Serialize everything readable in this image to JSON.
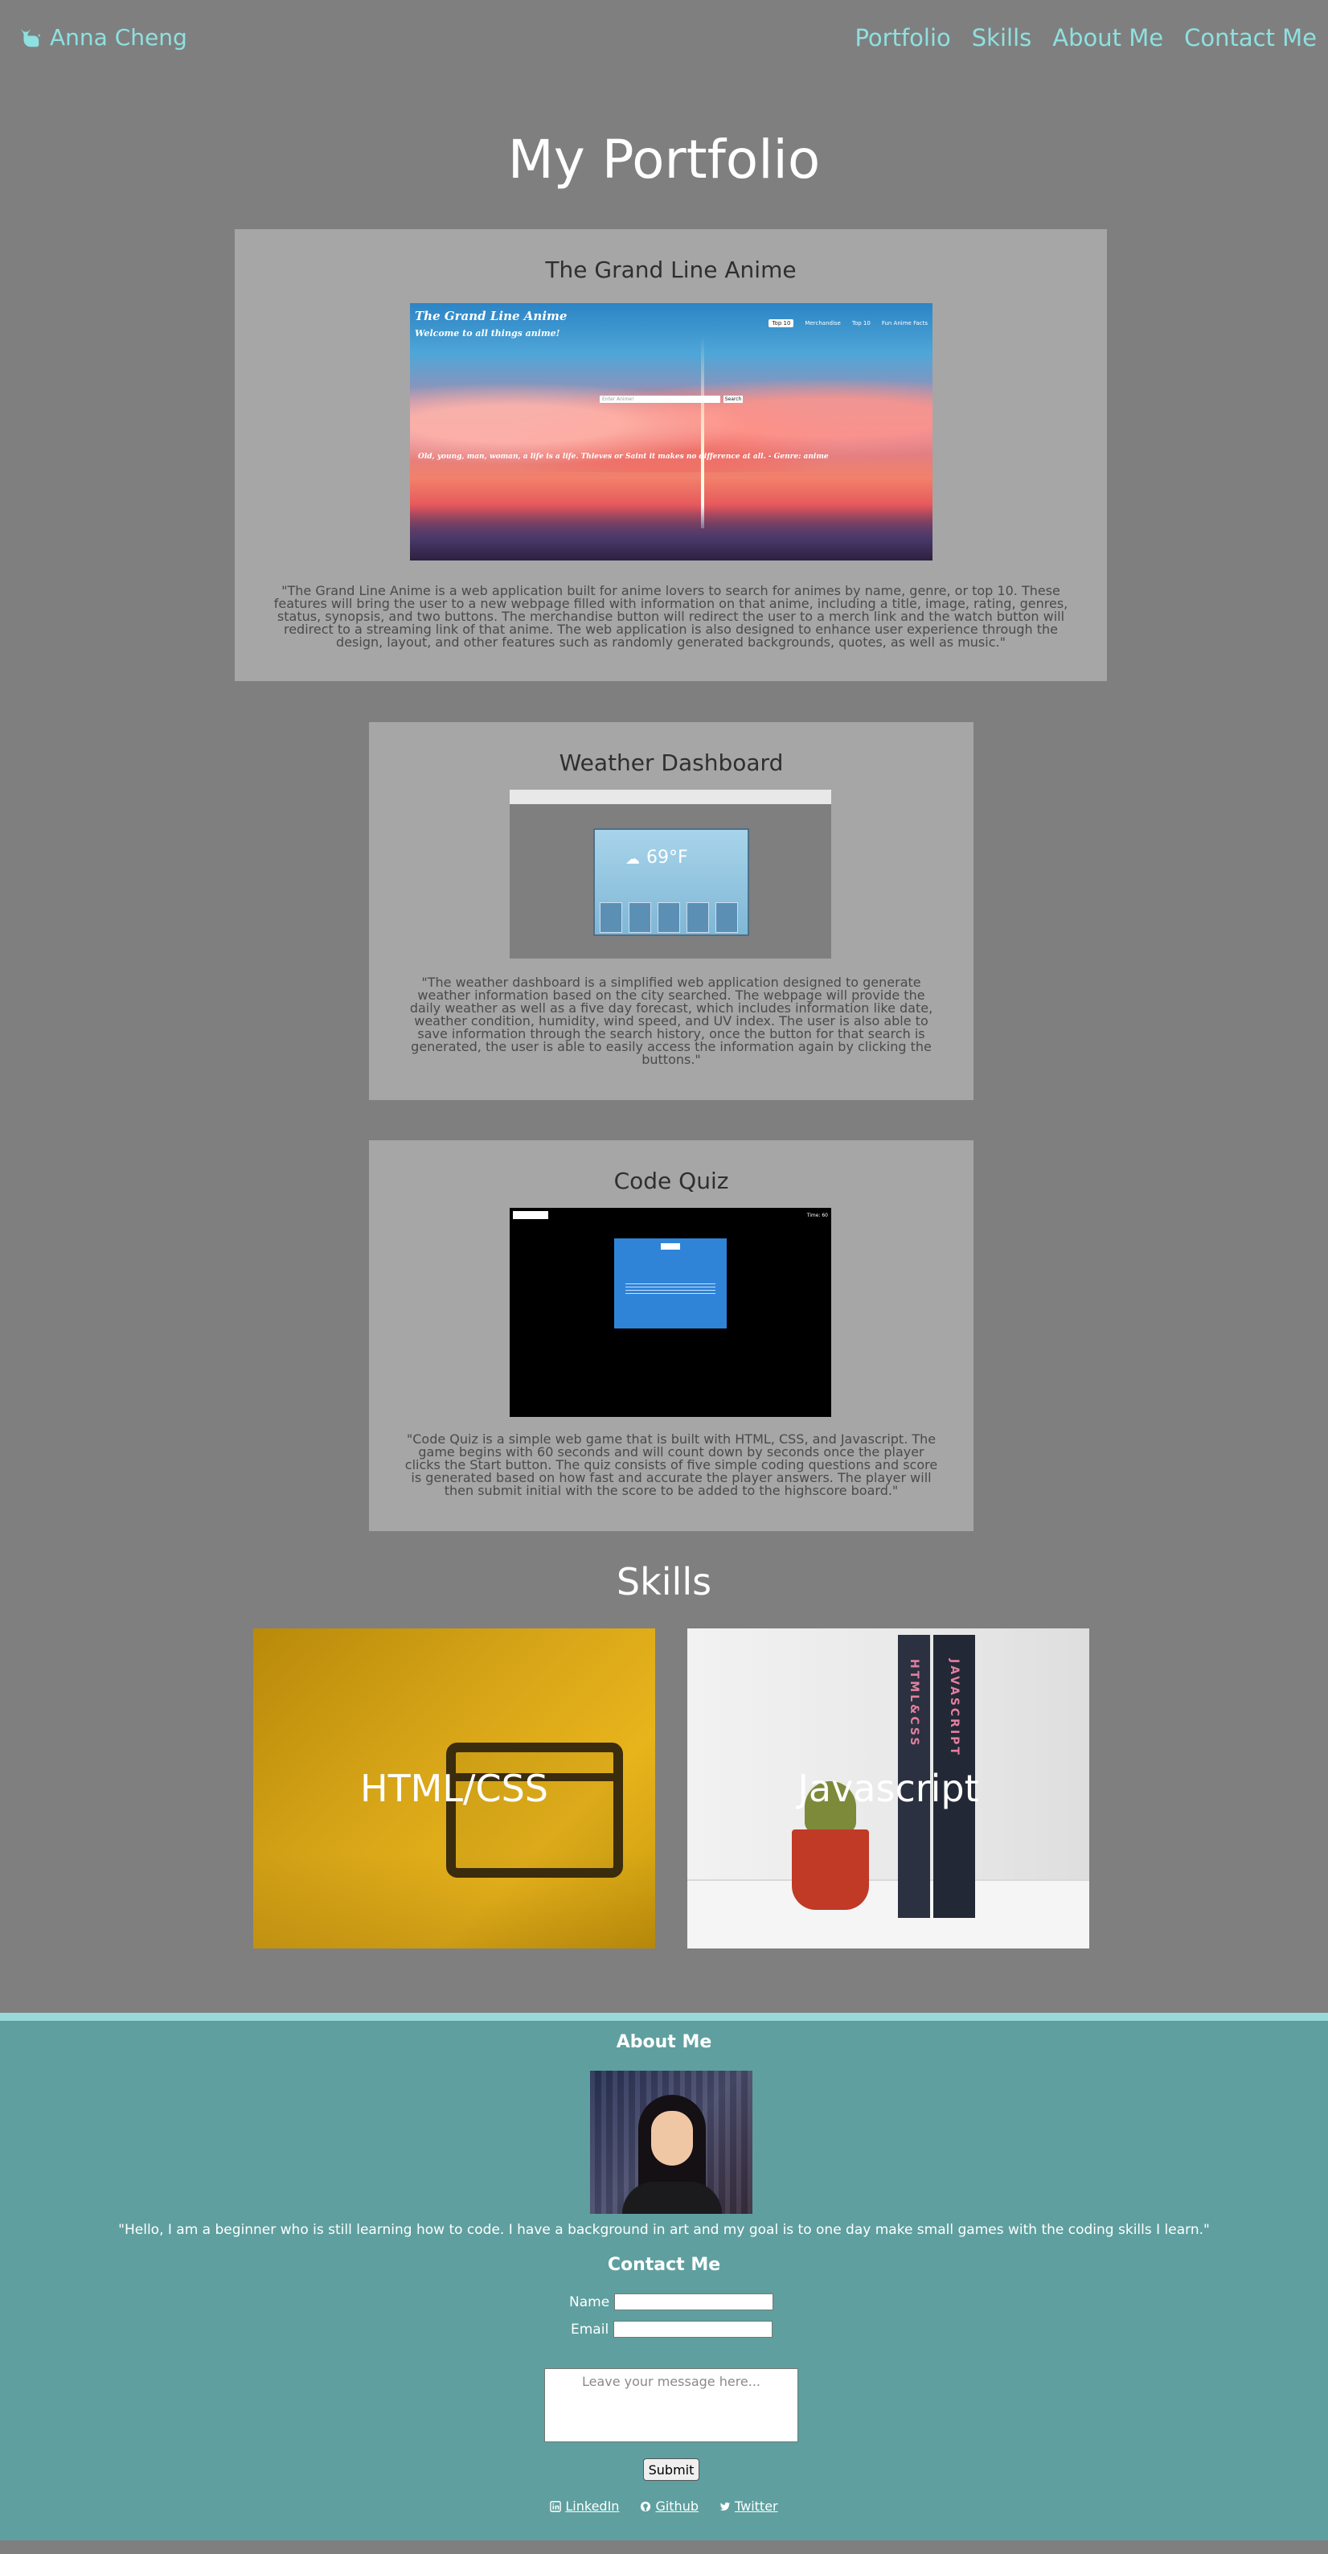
{
  "nav": {
    "brand": "Anna Cheng",
    "brand_icon": "cat-icon",
    "links": [
      "Portfolio",
      "Skills",
      "About Me",
      "Contact Me"
    ]
  },
  "portfolio": {
    "title": "My Portfolio",
    "projects": [
      {
        "title": "The Grand Line Anime",
        "screenshot": {
          "heading": "The Grand Line Anime",
          "subheading": "Welcome to all things anime!",
          "nav": [
            "Top 10",
            "Merchandise",
            "Top 10",
            "Fun Anime Facts"
          ],
          "search_placeholder": "Enter Anime!",
          "search_button": "Search",
          "quote": "Old, young, man, woman, a life is a life. Thieves or Saint it makes no difference at all. - Genre: anime"
        },
        "description": "\"The Grand Line Anime is a web application built for anime lovers to search for animes by name, genre, or top 10. These features will bring the user to a new webpage filled with information on that anime, including a title, image, rating, genres, status, synopsis, and two buttons. The merchandise button will redirect the user to a merch link and the watch button will redirect to a streaming link of that anime. The web application is also designed to enhance user experience through the design, layout, and other features such as randomly generated backgrounds, quotes, as well as music.\""
      },
      {
        "title": "Weather Dashboard",
        "screenshot": {
          "temp": "69°F"
        },
        "description": "\"The weather dashboard is a simplified web application designed to generate weather information based on the city searched. The webpage will provide the daily weather as well as a five day forecast, which includes information like date, weather condition, humidity, wind speed, and UV index. The user is also able to save information through the search history, once the button for that search is generated, the user is able to easily access the information again by clicking the buttons.\""
      },
      {
        "title": "Code Quiz",
        "screenshot": {
          "timer": "Time: 60"
        },
        "description": "\"Code Quiz is a simple web game that is built with HTML, CSS, and Javascript. The game begins with 60 seconds and will count down by seconds once the player clicks the Start button. The quiz consists of five simple coding questions and score is generated based on how fast and accurate the player answers. The player will then submit initial with the score to be added to the highscore board.\""
      }
    ]
  },
  "skills": {
    "title": "Skills",
    "items": [
      "HTML/CSS",
      "Javascript"
    ]
  },
  "about": {
    "title": "About Me",
    "bio": "\"Hello, I am a beginner who is still learning how to code. I have a background in art and my goal is to one day make small games with the coding skills I learn.\""
  },
  "contact": {
    "title": "Contact Me",
    "name_label": "Name",
    "email_label": "Email",
    "message_placeholder": "Leave your message here...",
    "submit_label": "Submit",
    "social": [
      {
        "label": "LinkedIn",
        "icon": "linkedin-icon"
      },
      {
        "label": "Github",
        "icon": "github-icon"
      },
      {
        "label": "Twitter",
        "icon": "twitter-icon"
      }
    ]
  },
  "colors": {
    "page_bg": "#7f7f7f",
    "accent": "#8fe0e0",
    "card_bg": "#a6a6a6",
    "footer_bg": "#5f9f9f"
  }
}
